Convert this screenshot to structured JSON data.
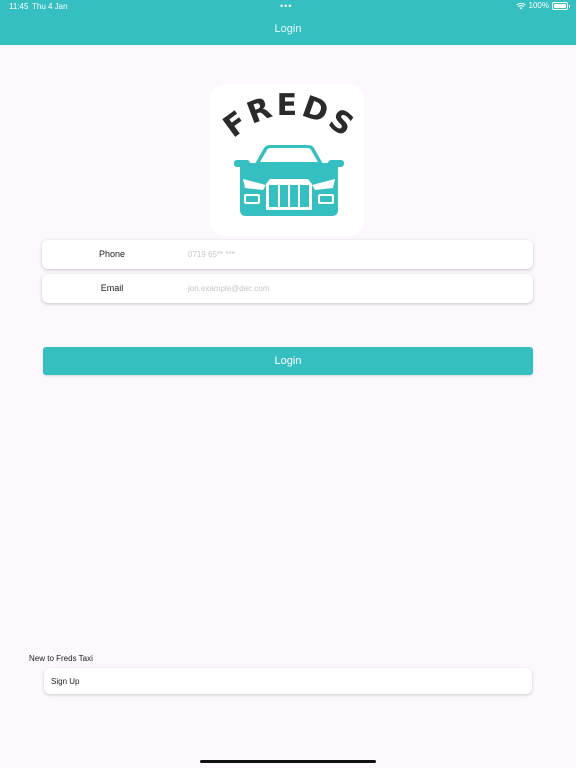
{
  "status_bar": {
    "time": "11:45",
    "date": "Thu 4 Jan",
    "dots": "•••",
    "battery": "100%"
  },
  "header": {
    "title": "Login"
  },
  "logo": {
    "text": "FREDS"
  },
  "form": {
    "phone_label": "Phone",
    "phone_placeholder": "0719 65** ***",
    "email_label": "Email",
    "email_placeholder": "jon.example@dec.com"
  },
  "login_button": "Login",
  "footer": {
    "prompt": "New to Freds Taxi",
    "signup_label": "Sign Up"
  },
  "colors": {
    "accent": "#35bfc0",
    "background": "#fcf8fd",
    "logo_text": "#2b2b2b"
  }
}
